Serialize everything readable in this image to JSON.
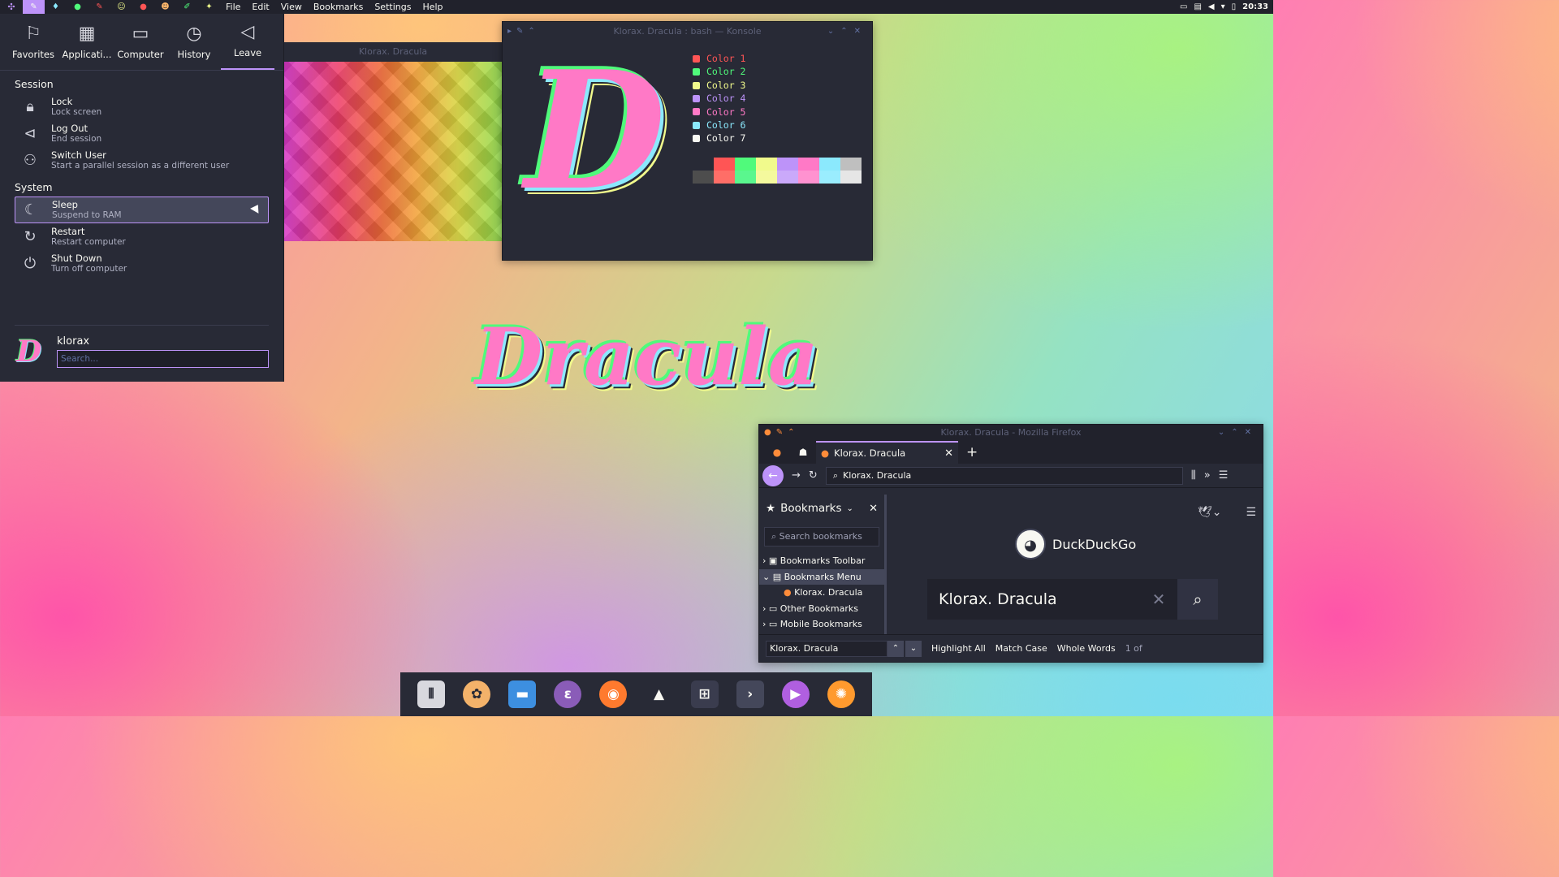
{
  "topbar": {
    "menu": [
      "File",
      "Edit",
      "View",
      "Bookmarks",
      "Settings",
      "Help"
    ],
    "clock": "20:33"
  },
  "launcher": {
    "tabs": [
      "Favorites",
      "Applicati...",
      "Computer",
      "History",
      "Leave"
    ],
    "active_tab": "Leave",
    "sections": [
      {
        "title": "Session",
        "items": [
          {
            "label": "Lock",
            "desc": "Lock screen",
            "icon": "lock-icon"
          },
          {
            "label": "Log Out",
            "desc": "End session",
            "icon": "logout-icon"
          },
          {
            "label": "Switch User",
            "desc": "Start a parallel session as a different user",
            "icon": "switch-user-icon"
          }
        ]
      },
      {
        "title": "System",
        "items": [
          {
            "label": "Sleep",
            "desc": "Suspend to RAM",
            "icon": "sleep-icon"
          },
          {
            "label": "Restart",
            "desc": "Restart computer",
            "icon": "restart-icon"
          },
          {
            "label": "Shut Down",
            "desc": "Turn off computer",
            "icon": "power-icon"
          }
        ]
      }
    ],
    "username": "klorax",
    "search_placeholder": "Search..."
  },
  "viewer": {
    "title": "Klorax. Dracula"
  },
  "konsole": {
    "title": "Klorax. Dracula : bash — Konsole",
    "colors": [
      {
        "label": "Color 1",
        "color": "#ff5555"
      },
      {
        "label": "Color 2",
        "color": "#50fa7b"
      },
      {
        "label": "Color 3",
        "color": "#f1fa8c"
      },
      {
        "label": "Color 4",
        "color": "#bd93f9"
      },
      {
        "label": "Color 5",
        "color": "#ff79c6"
      },
      {
        "label": "Color 6",
        "color": "#8be9fd"
      },
      {
        "label": "Color 7",
        "color": "#f8f8f2"
      }
    ],
    "palette_top": [
      "#282a36",
      "#ff5555",
      "#50fa7b",
      "#f1fa8c",
      "#bd93f9",
      "#ff79c6",
      "#8be9fd",
      "#bfbfbf"
    ],
    "palette_bottom": [
      "#4d4d4d",
      "#ff6e67",
      "#5af78e",
      "#f4f99d",
      "#caa9fa",
      "#ff92d0",
      "#9aedfe",
      "#e6e6e6"
    ]
  },
  "wallpaper_logo": "Dracula",
  "firefox": {
    "title": "Klorax. Dracula - Mozilla Firefox",
    "tab_label": "Klorax. Dracula",
    "url": "Klorax. Dracula",
    "sidebar_title": "Bookmarks",
    "sidebar_search": "Search bookmarks",
    "bookmarks": [
      "Bookmarks Toolbar",
      "Bookmarks Menu",
      "Klorax. Dracula",
      "Other Bookmarks",
      "Mobile Bookmarks"
    ],
    "brand": "DuckDuckGo",
    "search_value": "Klorax. Dracula",
    "find_value": "Klorax. Dracula",
    "find_options": [
      "Highlight All",
      "Match Case",
      "Whole Words"
    ],
    "find_count": "1 of"
  }
}
